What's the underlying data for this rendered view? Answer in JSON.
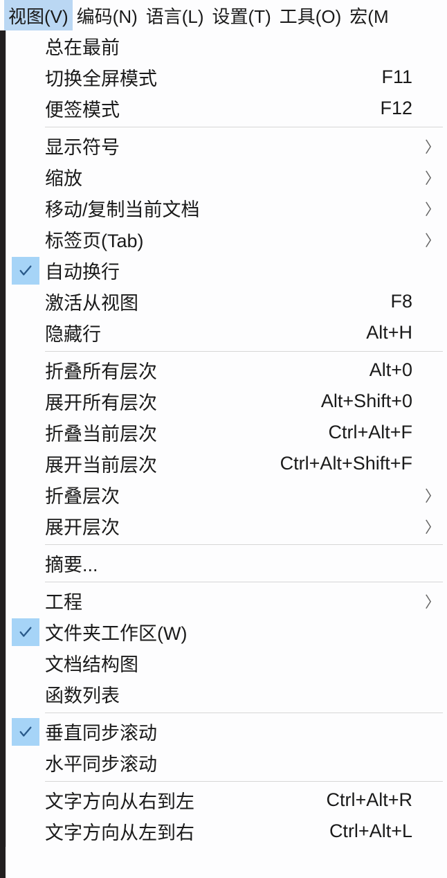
{
  "menubar": [
    {
      "id": "view",
      "label": "视图(V)",
      "active": true
    },
    {
      "id": "encoding",
      "label": "编码(N)"
    },
    {
      "id": "language",
      "label": "语言(L)"
    },
    {
      "id": "settings",
      "label": "设置(T)"
    },
    {
      "id": "tools",
      "label": "工具(O)"
    },
    {
      "id": "macro",
      "label": "宏(M"
    }
  ],
  "menu": {
    "groups": [
      [
        {
          "id": "always-on-top",
          "label": "总在最前"
        },
        {
          "id": "toggle-fullscreen",
          "label": "切换全屏模式",
          "shortcut": "F11"
        },
        {
          "id": "post-it",
          "label": "便签模式",
          "shortcut": "F12"
        }
      ],
      [
        {
          "id": "show-symbol",
          "label": "显示符号",
          "submenu": true
        },
        {
          "id": "zoom",
          "label": "缩放",
          "submenu": true
        },
        {
          "id": "move-clone",
          "label": "移动/复制当前文档",
          "submenu": true
        },
        {
          "id": "tab",
          "label": "标签页(Tab)",
          "submenu": true
        },
        {
          "id": "word-wrap",
          "label": "自动换行",
          "checked": true
        },
        {
          "id": "focus-other-view",
          "label": "激活从视图",
          "shortcut": "F8"
        },
        {
          "id": "hide-lines",
          "label": "隐藏行",
          "shortcut": "Alt+H"
        }
      ],
      [
        {
          "id": "fold-all",
          "label": "折叠所有层次",
          "shortcut": "Alt+0"
        },
        {
          "id": "unfold-all",
          "label": "展开所有层次",
          "shortcut": "Alt+Shift+0"
        },
        {
          "id": "collapse-current",
          "label": "折叠当前层次",
          "shortcut": "Ctrl+Alt+F"
        },
        {
          "id": "uncollapse-current",
          "label": "展开当前层次",
          "shortcut": "Ctrl+Alt+Shift+F"
        },
        {
          "id": "collapse-level",
          "label": "折叠层次",
          "submenu": true
        },
        {
          "id": "uncollapse-level",
          "label": "展开层次",
          "submenu": true
        }
      ],
      [
        {
          "id": "summary",
          "label": "摘要..."
        }
      ],
      [
        {
          "id": "project",
          "label": "工程",
          "submenu": true
        },
        {
          "id": "folder-workspace",
          "label": "文件夹工作区(W)",
          "checked": true
        },
        {
          "id": "doc-map",
          "label": "文档结构图"
        },
        {
          "id": "function-list",
          "label": "函数列表"
        }
      ],
      [
        {
          "id": "sync-v",
          "label": "垂直同步滚动",
          "checked": true
        },
        {
          "id": "sync-h",
          "label": "水平同步滚动"
        }
      ],
      [
        {
          "id": "text-rtl",
          "label": "文字方向从右到左",
          "shortcut": "Ctrl+Alt+R"
        },
        {
          "id": "text-ltr",
          "label": "文字方向从左到右",
          "shortcut": "Ctrl+Alt+L"
        }
      ]
    ]
  }
}
